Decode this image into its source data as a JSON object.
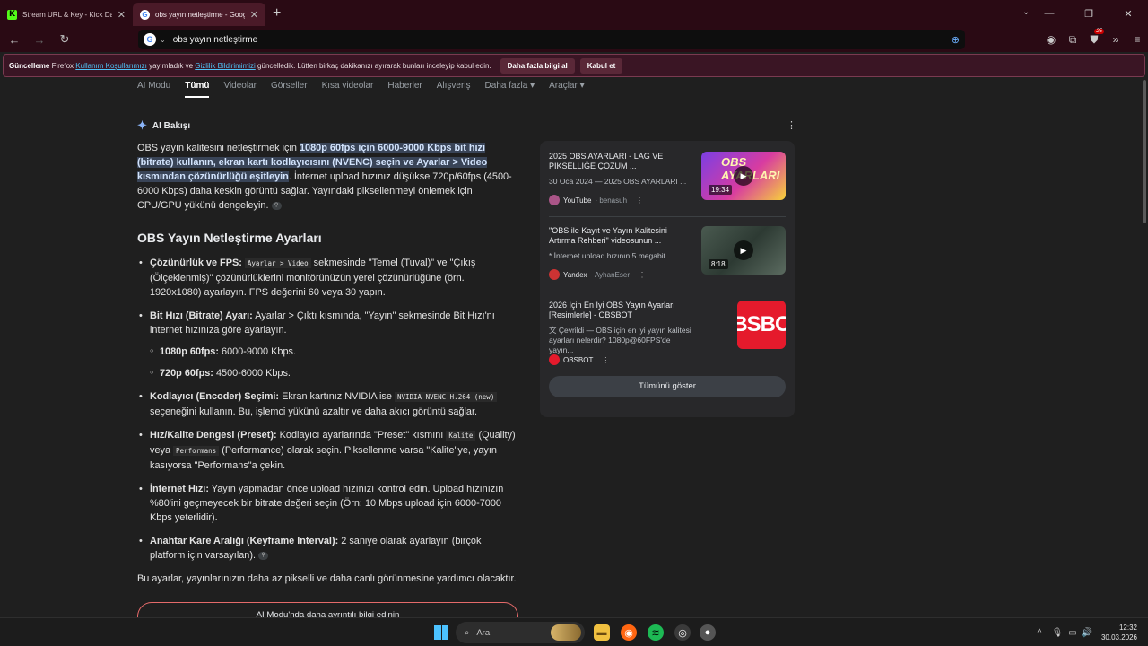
{
  "tabs": [
    {
      "label": "Stream URL & Key - Kick Dashb",
      "favicon": "kick-icon",
      "active": false
    },
    {
      "label": "obs yayın netleştirme - Google",
      "favicon": "google-icon",
      "active": true
    }
  ],
  "url": "obs yayın netleştirme",
  "extension_badge": "25",
  "notification": {
    "strong": "Güncelleme",
    "t1": "Firefox",
    "link1": "Kullanım Koşullarımızı",
    "t2": "yayımladık ve",
    "link2": "Gizlilik Bildirimimizi",
    "t3": "güncelledik. Lütfen birkaç dakikanızı ayırarak bunları inceleyip kabul edin.",
    "btn_more": "Daha fazla bilgi al",
    "btn_accept": "Kabul et"
  },
  "search_tabs": [
    "AI Modu",
    "Tümü",
    "Videolar",
    "Görseller",
    "Kısa videolar",
    "Haberler",
    "Alışveriş",
    "Daha fazla ▾",
    "Araçlar ▾"
  ],
  "ai": {
    "heading": "AI Bakışı",
    "intro_a": "OBS yayın kalitesini netleştirmek için ",
    "intro_hl": "1080p 60fps için 6000-9000 Kbps bit hızı (bitrate) kullanın, ekran kartı kodlayıcısını (NVENC) seçin ve Ayarlar > Video kısmından çözünürlüğü eşitleyin",
    "intro_b": ". İnternet upload hızınız düşükse 720p/60fps (4500-6000 Kbps) daha keskin görüntü sağlar. Yayındaki piksellenmeyi önlemek için CPU/GPU yükünü dengeleyin.",
    "section_title": "OBS Yayın Netleştirme Ayarları",
    "b1_strong": "Çözünürlük ve FPS:",
    "b1_code": "Ayarlar > Video",
    "b1_rest": " sekmesinde \"Temel (Tuval)\" ve \"Çıkış (Ölçeklenmiş)\" çözünürlüklerini monitörünüzün yerel çözünürlüğüne (örn. 1920x1080) ayarlayın. FPS değerini 60 veya 30 yapın.",
    "b2_strong": "Bit Hızı (Bitrate) Ayarı:",
    "b2_rest": " Ayarlar > Çıktı kısmında, \"Yayın\" sekmesinde Bit Hızı'nı internet hızınıza göre ayarlayın.",
    "b2_s1_strong": "1080p 60fps:",
    "b2_s1_rest": " 6000-9000 Kbps.",
    "b2_s2_strong": "720p 60fps:",
    "b2_s2_rest": " 4500-6000 Kbps.",
    "b3_strong": "Kodlayıcı (Encoder) Seçimi:",
    "b3_a": " Ekran kartınız NVIDIA ise ",
    "b3_code": "NVIDIA NVENC H.264 (new)",
    "b3_b": " seçeneğini kullanın. Bu, işlemci yükünü azaltır ve daha akıcı görüntü sağlar.",
    "b4_strong": "Hız/Kalite Dengesi (Preset):",
    "b4_a": " Kodlayıcı ayarlarında \"Preset\" kısmını ",
    "b4_code1": "Kalite",
    "b4_b": " (Quality) veya ",
    "b4_code2": "Performans",
    "b4_c": " (Performance) olarak seçin. Piksellenme varsa \"Kalite\"ye, yayın kasıyorsa \"Performans\"a çekin.",
    "b5_strong": "İnternet Hızı:",
    "b5_rest": " Yayın yapmadan önce upload hızınızı kontrol edin. Upload hızınızın %80'ini geçmeyecek bir bitrate değeri seçin (Örn: 10 Mbps upload için 6000-7000 Kbps yeterlidir).",
    "b6_strong": "Anahtar Kare Aralığı (Keyframe Interval):",
    "b6_rest": " 2 saniye olarak ayarlayın (birçok platform için varsayılan).",
    "closing": "Bu ayarlar, yayınlarınızın daha az pikselli ve daha canlı görünmesine yardımcı olacaktır.",
    "more_button": "AI Modu'nda daha ayrıntılı bilgi edinin"
  },
  "videos": [
    {
      "title": "2025 OBS AYARLARI - LAG VE PİKSELLİĞE ÇÖZÜM ...",
      "desc": "30 Oca 2024 — 2025 OBS AYARLARI ...",
      "source": "YouTube",
      "sub": "· benasuh",
      "duration": "19:34",
      "thumb_text": "OBS AYARLARI"
    },
    {
      "title": "\"OBS ile Kayıt ve Yayın Kalitesini Artırma Rehberi\" videosunun ...",
      "desc": "* İnternet upload hızının 5 megabit...",
      "source": "Yandex",
      "sub": "· AyhanEser",
      "duration": "8:18",
      "thumb_text": ""
    },
    {
      "title": "2026 İçin En İyi OBS Yayın Ayarları [Resimlerle] - OBSBOT",
      "desc": "文 Çevrildi — OBS için en iyi yayın kalitesi ayarları nelerdir? 1080p@60FPS'de yayın...",
      "source": "OBSBOT",
      "sub": "",
      "duration": "",
      "thumb_text": "BSBO"
    }
  ],
  "show_all": "Tümünü göster",
  "taskbar": {
    "search_placeholder": "Ara",
    "time": "12:32",
    "date": "30.03.2026"
  }
}
